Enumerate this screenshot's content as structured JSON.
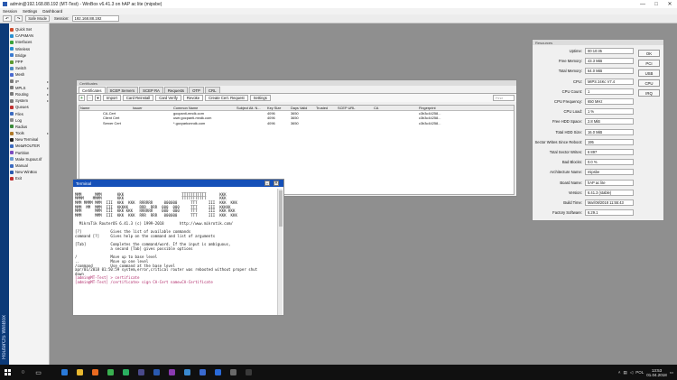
{
  "window": {
    "title": "admin@192.168.88.192 (MT-Test) - WinBox v6.41.3 on hAP ac lite (mipsbe)",
    "controls": [
      "—",
      "□",
      "✕"
    ]
  },
  "menu": [
    "Session",
    "Settings",
    "Dashboard"
  ],
  "toolbar": {
    "undo_icon": "undo-icon",
    "redo_icon": "redo-icon",
    "safe_mode_label": "Safe Mode",
    "session_label": "Session:",
    "session_value": "192.168.88.192"
  },
  "sidebar": {
    "brand": "RouterOS WinBox",
    "items": [
      {
        "label": "Quick Set",
        "color": "#d04a2a",
        "arrow": false
      },
      {
        "label": "CAPsMAN",
        "color": "#2a8fd0",
        "arrow": false
      },
      {
        "label": "Interfaces",
        "color": "#3aa33a",
        "arrow": false
      },
      {
        "label": "Wireless",
        "color": "#2a8fd0",
        "arrow": false
      },
      {
        "label": "Bridge",
        "color": "#3a7ad0",
        "arrow": false
      },
      {
        "label": "PPP",
        "color": "#5a9a30",
        "arrow": false
      },
      {
        "label": "Switch",
        "color": "#4a8ac0",
        "arrow": false
      },
      {
        "label": "Mesh",
        "color": "#4a6ad0",
        "arrow": false
      },
      {
        "label": "IP",
        "color": "#7a7a7a",
        "arrow": true
      },
      {
        "label": "MPLS",
        "color": "#7a7a7a",
        "arrow": true
      },
      {
        "label": "Routing",
        "color": "#7a7a7a",
        "arrow": true
      },
      {
        "label": "System",
        "color": "#7a7a7a",
        "arrow": true
      },
      {
        "label": "Queues",
        "color": "#c03030",
        "arrow": false
      },
      {
        "label": "Files",
        "color": "#3a6ac0",
        "arrow": false
      },
      {
        "label": "Log",
        "color": "#8a8a8a",
        "arrow": false
      },
      {
        "label": "Radius",
        "color": "#3a8a3a",
        "arrow": false
      },
      {
        "label": "Tools",
        "color": "#b07a2a",
        "arrow": true
      },
      {
        "label": "New Terminal",
        "color": "#222222",
        "arrow": false
      },
      {
        "label": "MetaROUTER",
        "color": "#3a6ac0",
        "arrow": false
      },
      {
        "label": "Partition",
        "color": "#7a4ac0",
        "arrow": false
      },
      {
        "label": "Make Supout.rif",
        "color": "#6a9ad0",
        "arrow": false
      },
      {
        "label": "Manual",
        "color": "#3a6ac0",
        "arrow": false
      },
      {
        "label": "New WinBox",
        "color": "#2a5ab0",
        "arrow": false
      },
      {
        "label": "Exit",
        "color": "#c03030",
        "arrow": false
      }
    ]
  },
  "certificates": {
    "title": "Certificates",
    "tabs": [
      "Certificates",
      "SCEP Servers",
      "SCEP RA",
      "Requests",
      "OTP",
      "CRL"
    ],
    "tool_icons": {
      "add": "+",
      "remove": "−",
      "filter": "▼"
    },
    "buttons": [
      "Import",
      "Card Reinstall",
      "Card Verify",
      "Revoke",
      "Create Cert. Request",
      "Settings"
    ],
    "find_placeholder": "Find",
    "columns": [
      "Name",
      "Issuer",
      "Common Name",
      "Subject Alt. N...",
      "Key Size",
      "Days Valid",
      "Trusted",
      "SCEP URL",
      "CA",
      "Fingerprint"
    ],
    "rows": [
      [
        "CA-Cert",
        "",
        "gocpanti-mndk.com",
        "",
        "4096",
        "3650",
        "",
        "",
        "",
        "c3b3c44258..."
      ],
      [
        "Client Cert",
        "",
        "user.gocpanti-mndk.com",
        "",
        "4096",
        "3650",
        "",
        "",
        "",
        "c3b3c44258..."
      ],
      [
        "Server Cert",
        "",
        "*.govyarkonndk.com",
        "",
        "4096",
        "3650",
        "",
        "",
        "",
        "c3b3c44258..."
      ]
    ]
  },
  "terminal": {
    "title": "Terminal",
    "lines": [
      "",
      "MMM      MMM       KKK                          TTTTTTTTTTT      KKK",
      "MMMM    MMMM       KKK                          TTTTTTTTTTT      KKK",
      "MMM MMMM MMM  III  KKK  KKK  RRRRRR     000000      TTT     III  KKK  KKK",
      "MMM  MM  MMM  III  KKKKK     RRR  RRR  000  000     TTT     III  KKKKK",
      "MMM      MMM  III  KKK KKK   RRRRRR    000  000     TTT     III  KKK KKK",
      "MMM      MMM  III  KKK  KKK  RRR  RRR   000000      TTT     III  KKK  KKK",
      "",
      "  MikroTik RouterOS 6.41.3 (c) 1999-2018       http://www.mikrotik.com/",
      "",
      "[?]             Gives the list of available commands",
      "command [?]     Gives help on the command and list of arguments",
      "",
      "[Tab]           Completes the command/word. If the input is ambiguous,",
      "                a second [Tab] gives possible options",
      "",
      "/               Move up to base level",
      "..              Move up one level",
      "/command        Use command at the base level",
      "apr/01/2018 01:50:59 system,error,critical router was rebooted without proper shut",
      "down",
      "[admin@MT-Test] > certificate",
      "[admin@MT-Test] /certificate> sign CA-Cert name=CA-Certificate"
    ]
  },
  "resources": {
    "title": "Resources",
    "rows": [
      {
        "label": "Uptime:",
        "value": "00:10:35"
      },
      {
        "label": "Free Memory:",
        "value": "43.3 MiB"
      },
      {
        "label": "Total Memory:",
        "value": "64.0 MiB"
      },
      {
        "label": "CPU:",
        "value": "MIPS 24Kc V7.4"
      },
      {
        "label": "CPU Count:",
        "value": "1"
      },
      {
        "label": "CPU Frequency:",
        "value": "650 MHz"
      },
      {
        "label": "CPU Load:",
        "value": "1 %"
      },
      {
        "label": "Free HDD Space:",
        "value": "2.8 MiB"
      },
      {
        "label": "Total HDD Size:",
        "value": "16.0 MiB"
      },
      {
        "label": "Sector Writes Since Reboot:",
        "value": "195"
      },
      {
        "label": "Total Sector Writes:",
        "value": "6 897"
      },
      {
        "label": "Bad Blocks:",
        "value": "0.0 %"
      },
      {
        "label": "Architecture Name:",
        "value": "mipsbe"
      },
      {
        "label": "Board Name:",
        "value": "hAP ac lite"
      },
      {
        "label": "Version:",
        "value": "6.41.3 (stable)"
      },
      {
        "label": "Build Time:",
        "value": "Mar/08/2018 11:55:43"
      },
      {
        "label": "Factory Software:",
        "value": "6.29.1"
      }
    ],
    "buttons": [
      "OK",
      "PCI",
      "USB",
      "CPU",
      "IRQ"
    ]
  },
  "taskbar": {
    "start_icon": "windows-start-icon",
    "apps": [
      {
        "name": "search",
        "glyph": "○",
        "color": ""
      },
      {
        "name": "task-view",
        "glyph": "▭",
        "color": ""
      },
      {
        "name": "edge",
        "glyph": "",
        "color": "#2a7ad8"
      },
      {
        "name": "explorer",
        "glyph": "",
        "color": "#e8b830"
      },
      {
        "name": "firefox",
        "glyph": "",
        "color": "#e86a20"
      },
      {
        "name": "chrome",
        "glyph": "",
        "color": "#3ab050"
      },
      {
        "name": "spotify",
        "glyph": "",
        "color": "#2ab060"
      },
      {
        "name": "media",
        "glyph": "",
        "color": "#4a4a8a"
      },
      {
        "name": "winbox",
        "glyph": "",
        "color": "#2a5ab0"
      },
      {
        "name": "onenote",
        "glyph": "",
        "color": "#8a3ab0"
      },
      {
        "name": "photos",
        "glyph": "",
        "color": "#3a8ad0"
      },
      {
        "name": "store",
        "glyph": "",
        "color": "#3a6ad0"
      },
      {
        "name": "mail",
        "glyph": "",
        "color": "#2a6ad8"
      },
      {
        "name": "app",
        "glyph": "",
        "color": "#6a6a6a"
      },
      {
        "name": "terminal",
        "glyph": "",
        "color": "#3a3a3a"
      }
    ],
    "lang": "POL",
    "time": "13:53",
    "date": "01.04.2018"
  }
}
